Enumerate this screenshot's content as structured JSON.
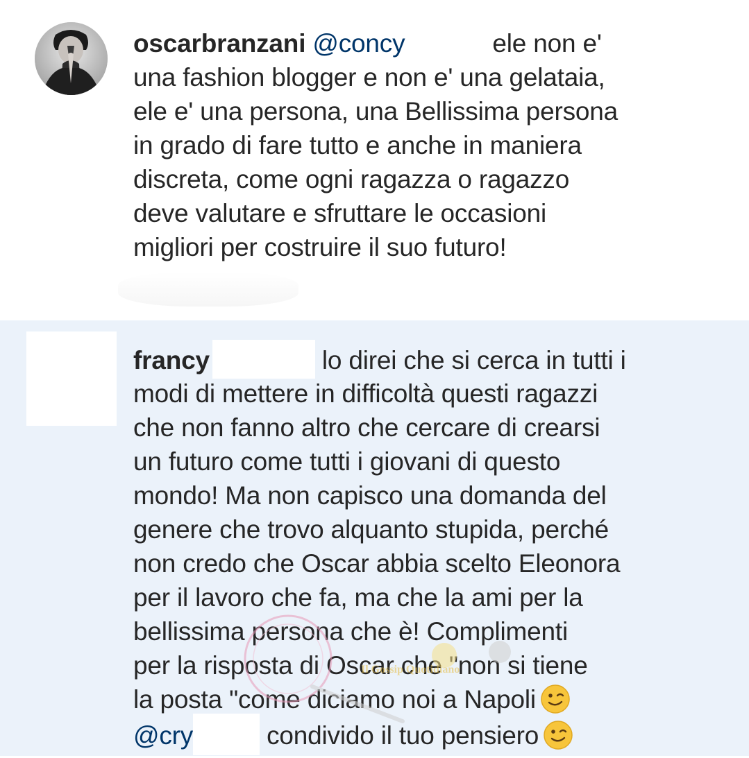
{
  "comments": [
    {
      "username": "oscarbranzani",
      "mention": "@concy",
      "lines": [
        "ele non e'",
        "una fashion blogger e non e' una gelataia,",
        "ele e' una persona, una Bellissima persona",
        "in grado di fare tutto e anche in maniera",
        "discreta, come ogni ragazza o ragazzo",
        "deve valutare e sfruttare le occasioni",
        "migliori per costruire il suo futuro!"
      ]
    },
    {
      "username": "francy",
      "lines": [
        "lo direi che si cerca in tutti i",
        "modi di mettere in difficoltà questi ragazzi",
        "che non fanno altro che cercare di crearsi",
        "un futuro come tutti i giovani di questo",
        "mondo! Ma non capisco una domanda del",
        "genere che trovo alquanto stupida, perché",
        "non credo che Oscar abbia scelto Eleonora",
        "per il lavoro che fa, ma che la ami per la",
        "bellissima  persona che è! Complimenti",
        "per la risposta di Oscar che \"non si tiene",
        "la posta \"come diciamo noi a Napoli"
      ],
      "mention_line": {
        "mention": "@cry",
        "text": "condivido il tuo pensiero"
      }
    }
  ],
  "watermark": {
    "text": "Il Gossip Quotidiano"
  },
  "icons": {
    "avatar_1": "user-praying-avatar-icon",
    "emoji": "winking-face-icon"
  }
}
